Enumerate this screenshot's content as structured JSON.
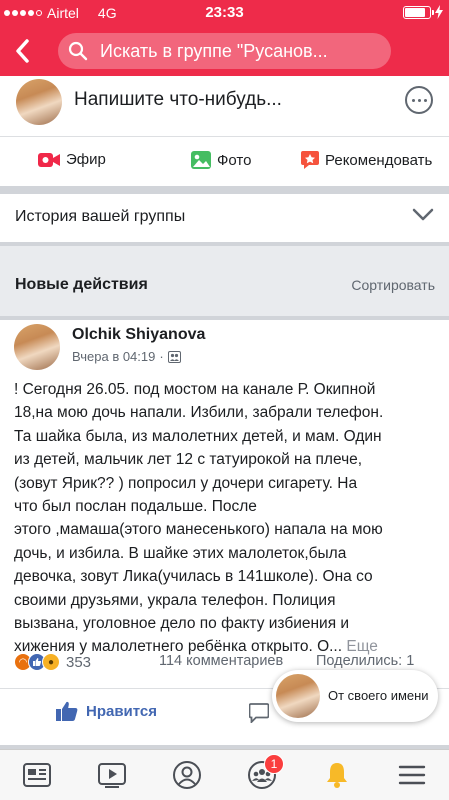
{
  "status_bar": {
    "carrier": "Airtel",
    "network": "4G",
    "time": "23:33",
    "battery_level": 0.85
  },
  "nav": {
    "search_text": "Искать в группе \"Русанов..."
  },
  "composer": {
    "prompt": "Напишите что-нибудь..."
  },
  "actions": {
    "live": "Эфир",
    "photo": "Фото",
    "recommend": "Рекомендовать"
  },
  "story": {
    "title": "История вашей группы"
  },
  "section": {
    "title": "Новые действия",
    "sort": "Сортировать"
  },
  "post": {
    "author": "Olchik Shiyanova",
    "time": "Вчера в 04:19",
    "separator": "·",
    "lines": [
      "!  Сегодня 26.05. под мостом на канале  Р. Окипной",
      "18,на мою дочь напали.  Избили, забрали телефон.",
      "Та шайка была, из  малолетних детей, и мам. Один",
      "из детей, мальчик лет 12 с татуирокой на плече,",
      "(зовут Ярик?? ) попросил у дочери сигарету. На",
      "что был послан подальше. После",
      "этого ,мамаша(этого манесенького) напала на мою",
      "дочь, и избила.   В шайке этих  малолеток,была",
      "девочка, зовут Лика(училась в 141школе). Она со",
      "своими  друзьями, украла телефон. Полиция",
      "вызвана, уголовное дело по факту избиения и"
    ],
    "last_line": "хижения у малолетнего ребёнка  открыто.  О...",
    "more": "Еще",
    "reaction_count": "353",
    "comments": "114 комментариев",
    "shares": "Поделились: 1",
    "like_label": "Нравится"
  },
  "chat_head": {
    "text": "От своего имени"
  },
  "tab_bar": {
    "notification_badge": "1"
  },
  "colors": {
    "brand_red": "#ee2b4a",
    "facebook_blue": "#4267b2",
    "badge_red": "#fa3e3e"
  }
}
